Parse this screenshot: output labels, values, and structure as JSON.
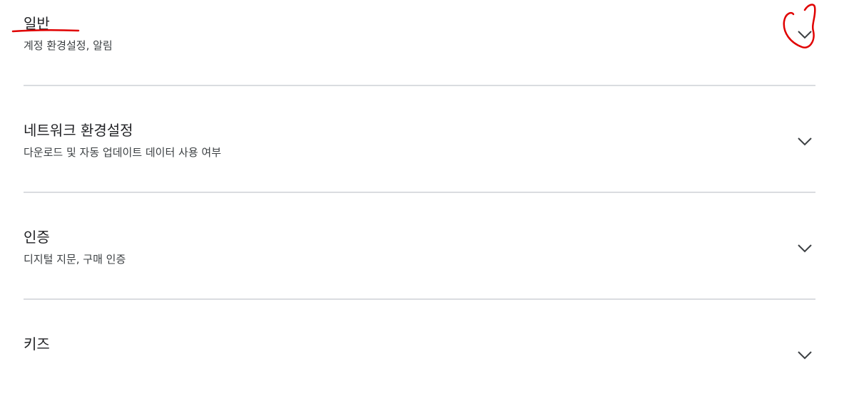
{
  "settings": {
    "items": [
      {
        "title": "일반",
        "subtitle": "계정 환경설정, 알림",
        "icon": "chevron-down-icon"
      },
      {
        "title": "네트워크 환경설정",
        "subtitle": "다운로드 및 자동 업데이트 데이터 사용 여부",
        "icon": "chevron-down-icon"
      },
      {
        "title": "인증",
        "subtitle": "디지털 지문, 구매 인증",
        "icon": "chevron-down-icon"
      },
      {
        "title": "키즈",
        "subtitle": "",
        "icon": "chevron-down-icon"
      }
    ]
  },
  "colors": {
    "title_text": "#202124",
    "subtitle_text": "#3c4043",
    "divider": "#dadce0",
    "chevron": "#3c4043",
    "annotation_red": "#e00000"
  }
}
